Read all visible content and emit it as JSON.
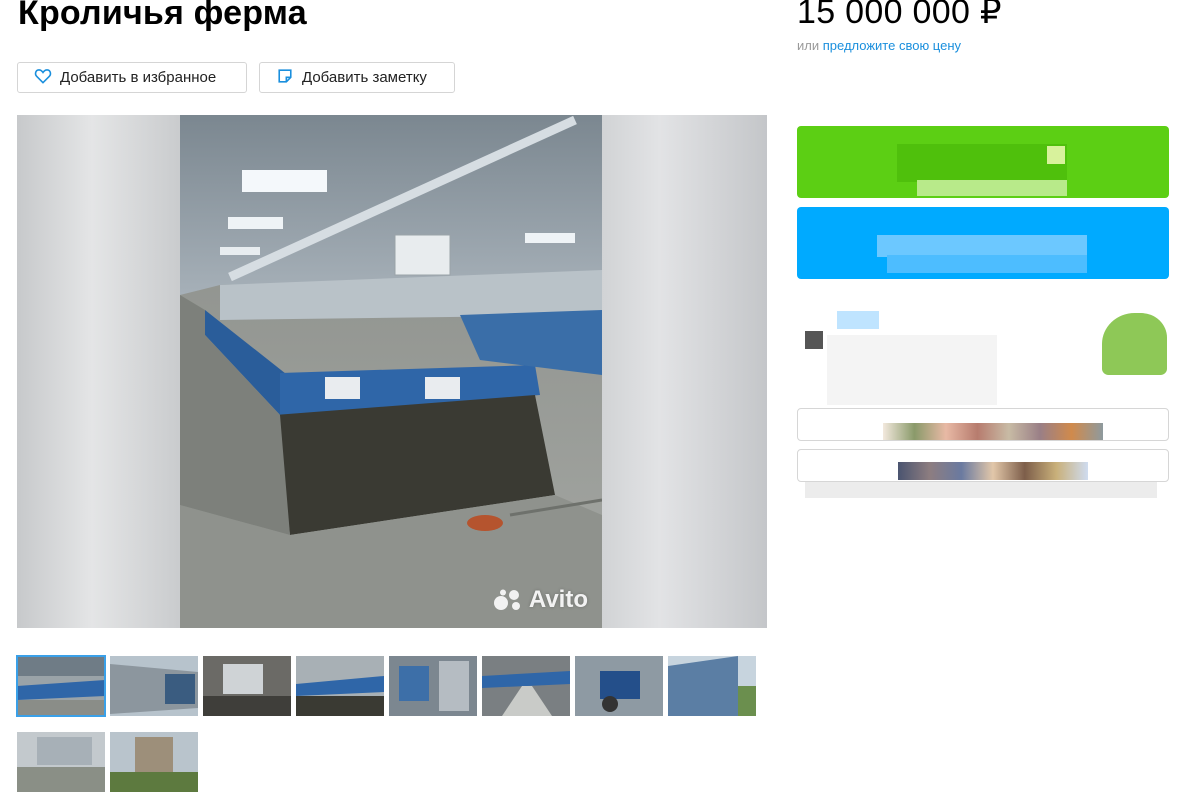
{
  "listing": {
    "title": "Кроличья ферма",
    "price": "15 000 000 ₽",
    "offer_prefix": "или",
    "offer_link": "предложите свою цену"
  },
  "actions": {
    "favorite_label": "Добавить в избранное",
    "note_label": "Добавить заметку"
  },
  "gallery": {
    "watermark": "Avito",
    "selected_index": 0,
    "thumbnail_count": 10
  },
  "colors": {
    "accent_green": "#5ccf14",
    "accent_blue": "#00aaff",
    "link": "#1a8fdd",
    "selected_outline": "#3aa0e8"
  }
}
